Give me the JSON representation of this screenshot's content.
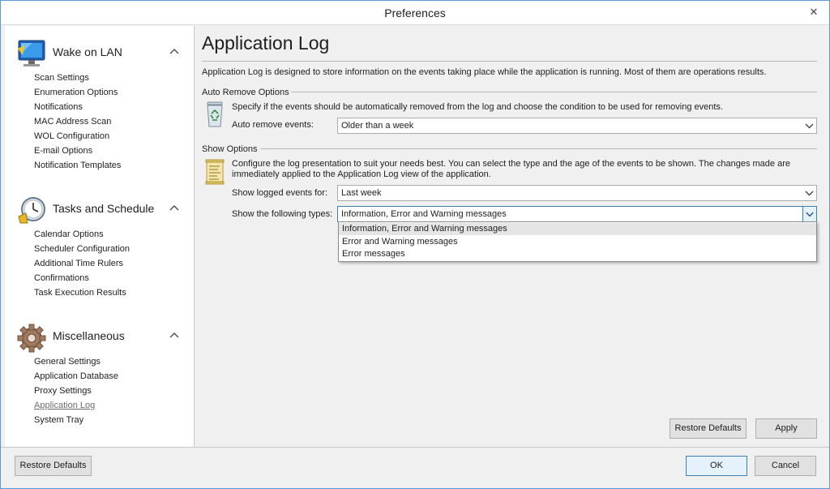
{
  "window": {
    "title": "Preferences",
    "close_glyph": "✕"
  },
  "sidebar": {
    "groups": [
      {
        "label": "Wake on LAN",
        "icon": "monitor-icon",
        "items": [
          "Scan Settings",
          "Enumeration Options",
          "Notifications",
          "MAC Address Scan",
          "WOL Configuration",
          "E-mail Options",
          "Notification Templates"
        ]
      },
      {
        "label": "Tasks and Schedule",
        "icon": "clock-icon",
        "items": [
          "Calendar Options",
          "Scheduler Configuration",
          "Additional Time Rulers",
          "Confirmations",
          "Task Execution Results"
        ]
      },
      {
        "label": "Miscellaneous",
        "icon": "gear-icon",
        "items": [
          "General Settings",
          "Application Database",
          "Proxy Settings",
          "Application Log",
          "System Tray"
        ]
      }
    ],
    "active_item": "Application Log"
  },
  "main": {
    "title": "Application Log",
    "description": "Application Log is designed to store information on the events taking place while the application is running. Most of them are operations results.",
    "auto_remove": {
      "section_label": "Auto Remove Options",
      "icon": "recycle-bin-icon",
      "text": "Specify if the events should be automatically removed from the log and choose the condition to be used for removing events.",
      "field_label": "Auto remove events:",
      "value": "Older than a week"
    },
    "show_options": {
      "section_label": "Show Options",
      "icon": "log-document-icon",
      "text": "Configure the log presentation to suit your needs best. You can select the type and the age of the events to be shown. The changes made are immediately applied to the Application Log view of the application.",
      "logged_label": "Show logged events for:",
      "logged_value": "Last week",
      "types_label": "Show the following types:",
      "types_value": "Information, Error and Warning messages",
      "types_options": [
        "Information, Error and Warning messages",
        "Error and Warning messages",
        "Error messages"
      ]
    },
    "restore_defaults": "Restore Defaults",
    "apply": "Apply"
  },
  "footer": {
    "restore_defaults": "Restore Defaults",
    "ok": "OK",
    "cancel": "Cancel"
  },
  "colors": {
    "accent": "#3c7fb1",
    "window_border": "#5a9ad8",
    "background": "#f0f0f0"
  }
}
